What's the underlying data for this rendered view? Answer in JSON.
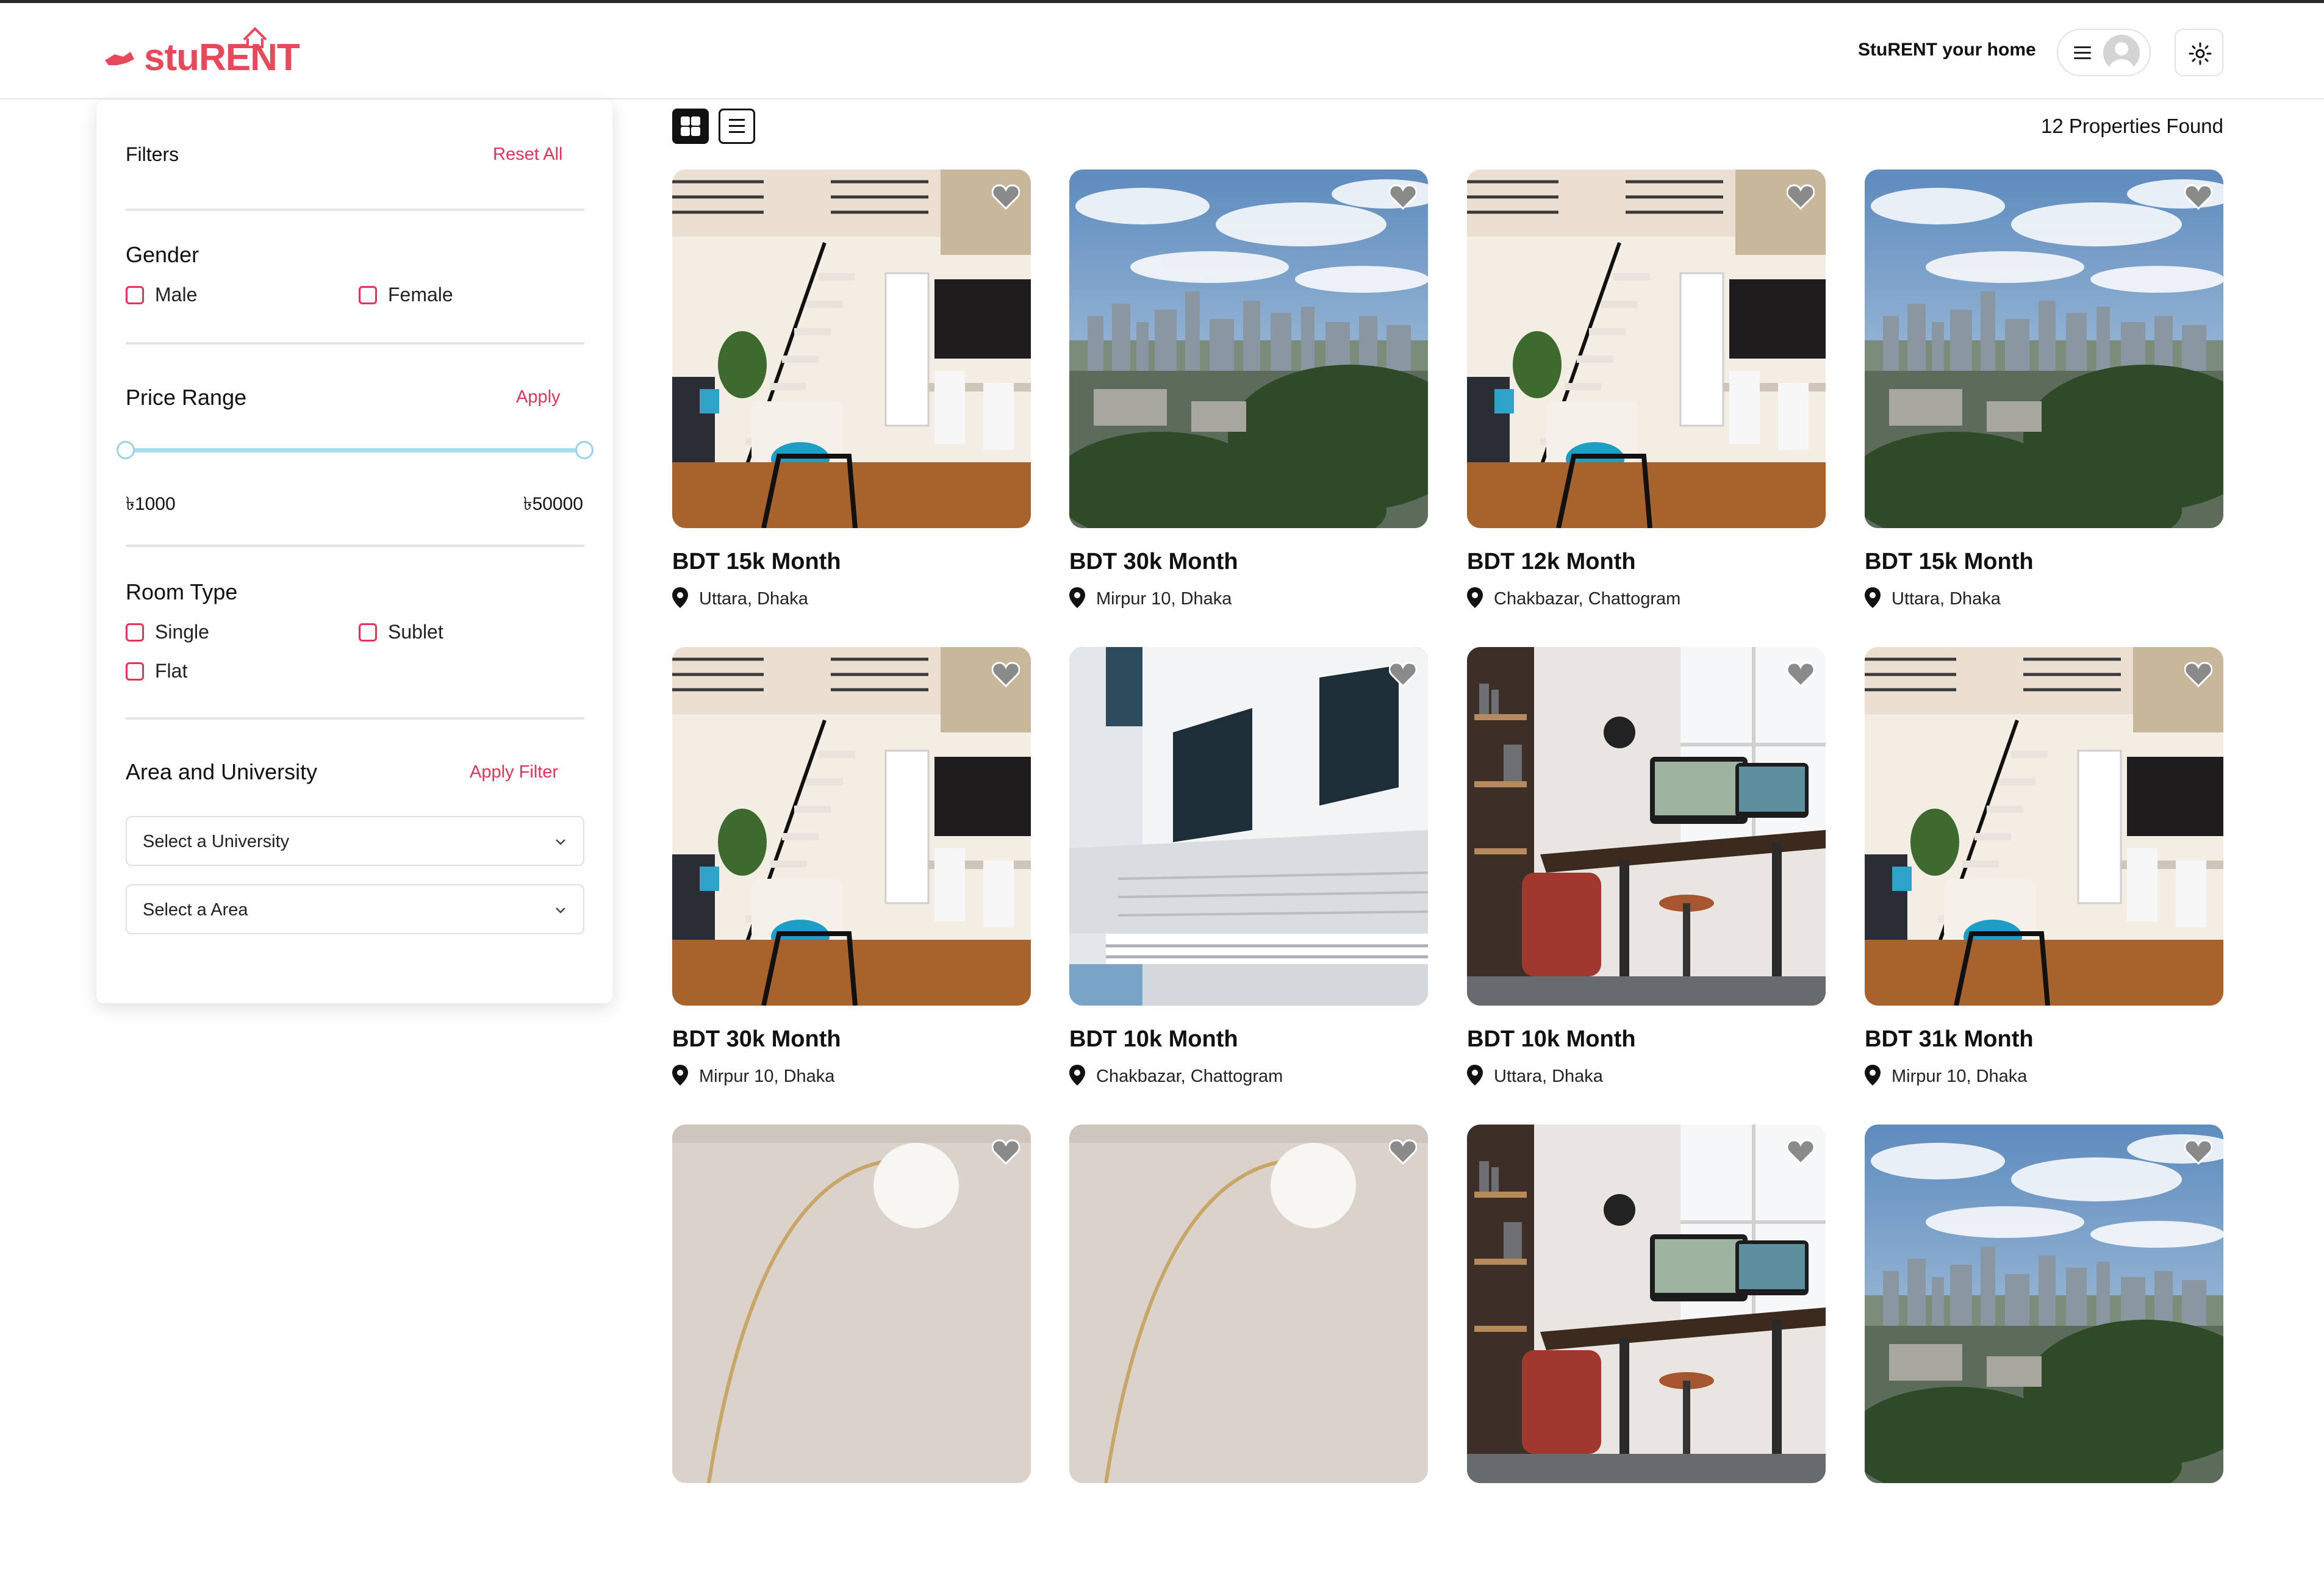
{
  "brand": {
    "name": "stuRENT",
    "accent": "#e8495a",
    "link_color": "#e8315a"
  },
  "header": {
    "tagline": "StuRENT your home",
    "menu_icon": "hamburger-icon",
    "avatar_icon": "user-avatar-icon",
    "theme_icon": "sun-icon"
  },
  "filters": {
    "title": "Filters",
    "reset_label": "Reset All",
    "gender": {
      "title": "Gender",
      "options": [
        "Male",
        "Female"
      ]
    },
    "price": {
      "title": "Price Range",
      "apply_label": "Apply",
      "min_label": "৳1000",
      "max_label": "৳50000",
      "min": 1000,
      "max": 50000
    },
    "room_type": {
      "title": "Room Type",
      "options": [
        "Single",
        "Sublet",
        "Flat"
      ]
    },
    "area": {
      "title": "Area and University",
      "apply_label": "Apply Filter",
      "university_placeholder": "Select a University",
      "area_placeholder": "Select a Area"
    }
  },
  "results": {
    "count_label": "12 Properties Found",
    "view_modes": [
      "grid",
      "list"
    ],
    "active_view": "grid",
    "listings": [
      {
        "price": "BDT 15k Month",
        "location": "Uttara, Dhaka",
        "photo": "loft-interior"
      },
      {
        "price": "BDT 30k Month",
        "location": "Mirpur 10, Dhaka",
        "photo": "city-skyline"
      },
      {
        "price": "BDT 12k Month",
        "location": "Chakbazar, Chattogram",
        "photo": "loft-interior"
      },
      {
        "price": "BDT 15k Month",
        "location": "Uttara, Dhaka",
        "photo": "city-skyline"
      },
      {
        "price": "BDT 30k Month",
        "location": "Mirpur 10, Dhaka",
        "photo": "loft-interior"
      },
      {
        "price": "BDT 10k Month",
        "location": "Chakbazar, Chattogram",
        "photo": "white-building"
      },
      {
        "price": "BDT 10k Month",
        "location": "Uttara, Dhaka",
        "photo": "study-room"
      },
      {
        "price": "BDT 31k Month",
        "location": "Mirpur 10, Dhaka",
        "photo": "loft-interior"
      },
      {
        "price": "",
        "location": "",
        "photo": "lamp-room"
      },
      {
        "price": "",
        "location": "",
        "photo": "lamp-room"
      },
      {
        "price": "",
        "location": "",
        "photo": "study-room"
      },
      {
        "price": "",
        "location": "",
        "photo": "city-skyline"
      }
    ]
  }
}
